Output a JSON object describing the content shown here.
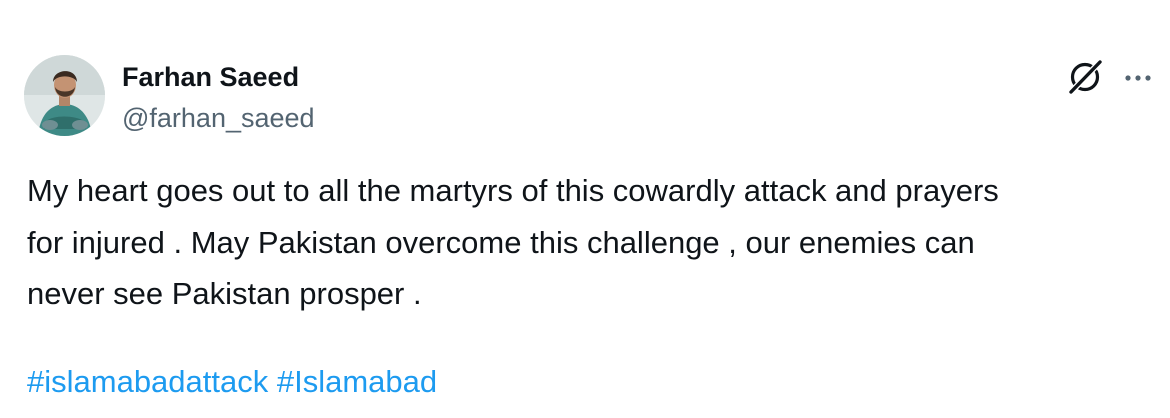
{
  "author": {
    "name": "Farhan Saeed",
    "handle": "@farhan_saeed"
  },
  "icons": {
    "grok": "grok-icon",
    "more": "more-options-icon"
  },
  "tweet": {
    "lines": [
      "My heart goes out to all the martyrs of this cowardly attack and prayers",
      "for injured . May Pakistan overcome this challenge , our enemies can",
      "never see Pakistan prosper ."
    ],
    "hashtags": [
      "#islamabadattack",
      "#Islamabad"
    ]
  },
  "colors": {
    "text": "#0f1419",
    "secondary": "#536471",
    "link": "#1d9bf0"
  }
}
